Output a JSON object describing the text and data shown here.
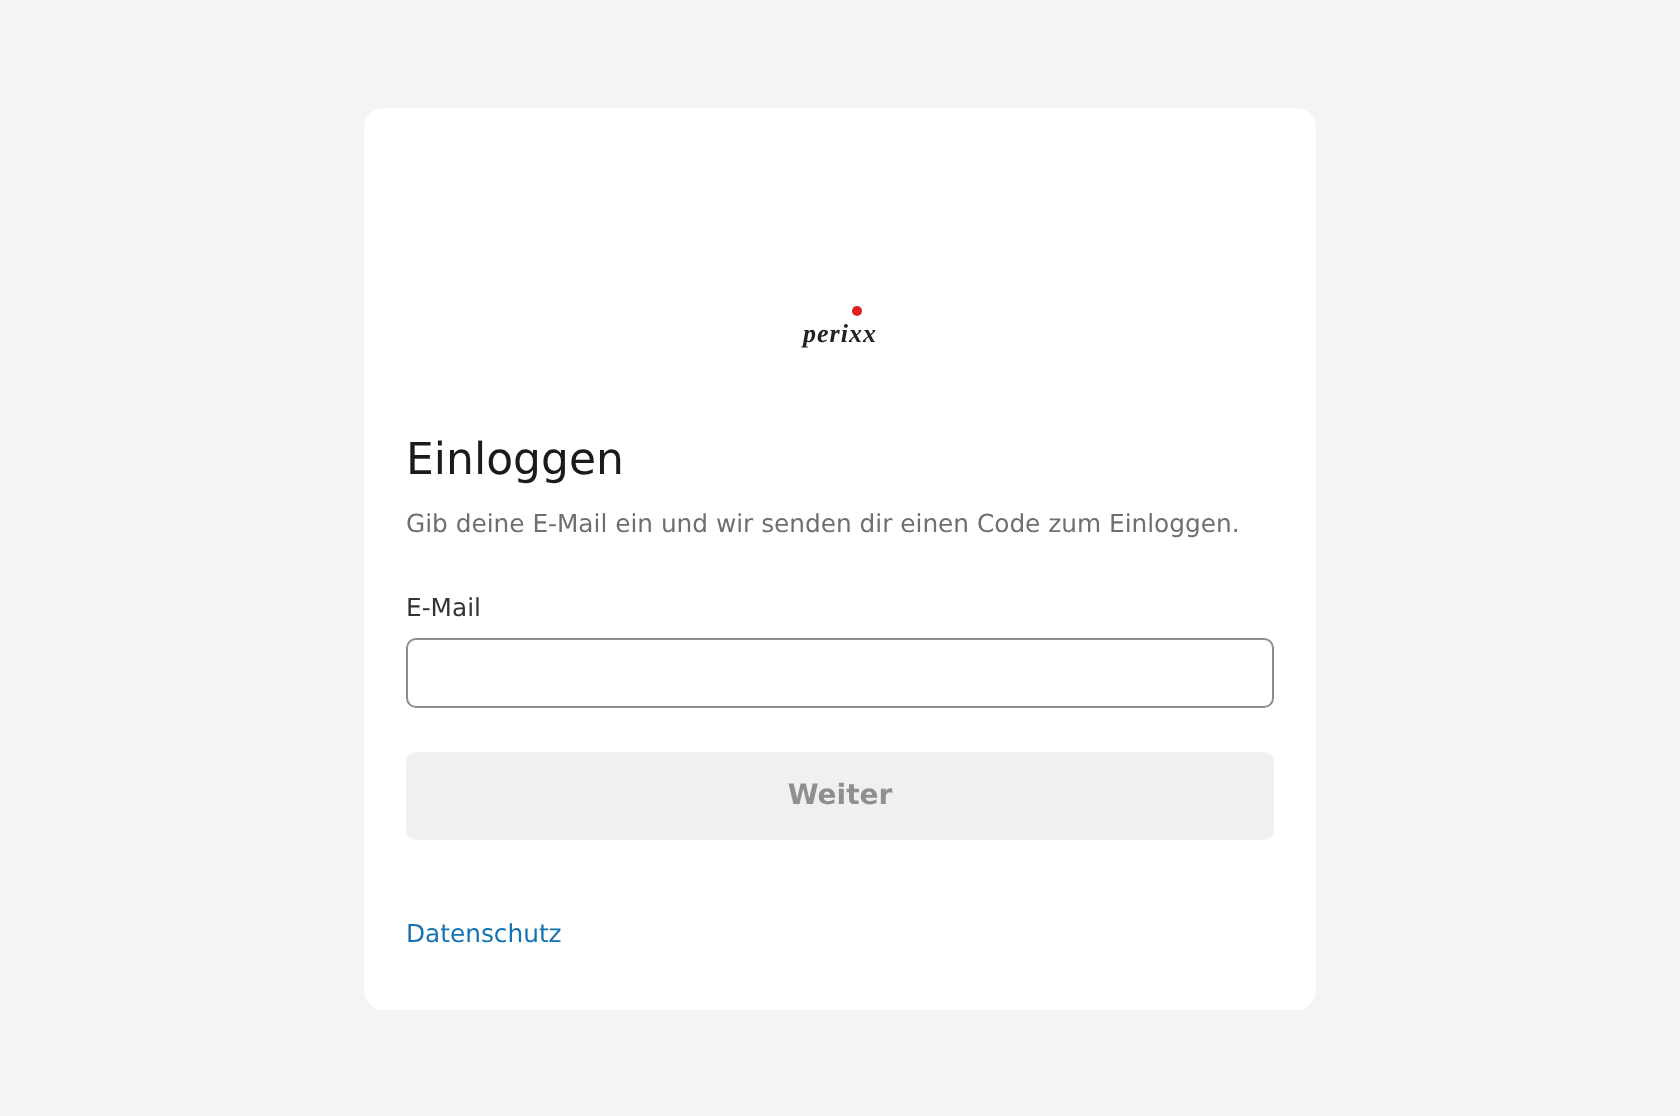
{
  "logo": {
    "text": "perixx"
  },
  "heading": "Einloggen",
  "subtitle": "Gib deine E-Mail ein und wir senden dir einen Code zum Einloggen.",
  "email_field": {
    "label": "E-Mail"
  },
  "continue_button": {
    "label": "Weiter",
    "disabled": true
  },
  "footer_link": "Datenschutz"
}
